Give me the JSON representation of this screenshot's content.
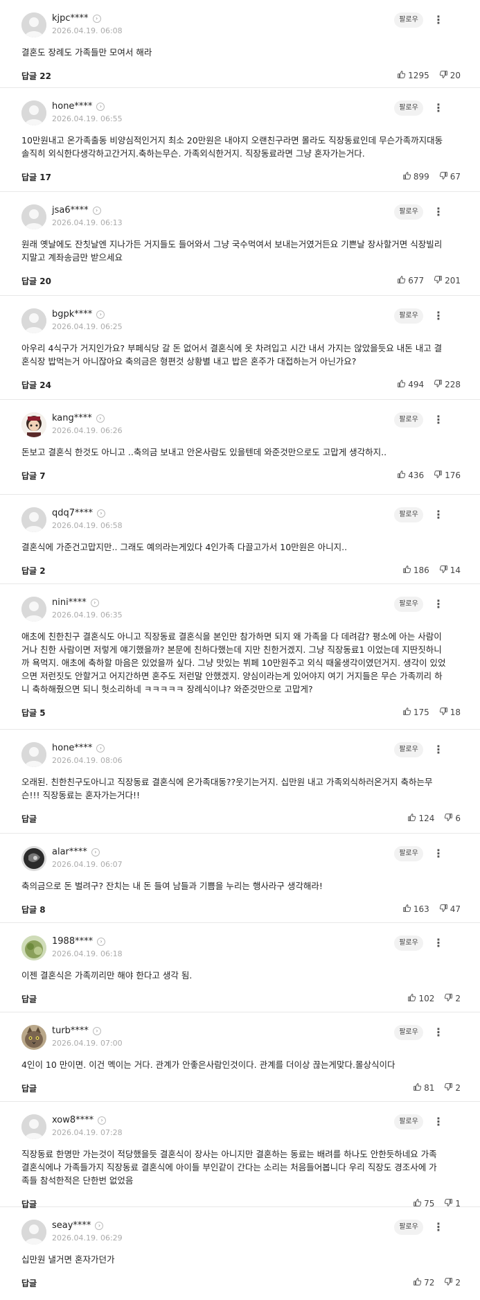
{
  "follow_label": "팔로우",
  "more_glyph": "⋮",
  "level_glyph": "›",
  "comments": [
    {
      "user": "kjpc****",
      "date": "2026.04.19. 06:08",
      "text": [
        "결혼도 장례도 가족들만 모여서 해라"
      ],
      "replies": "답글 22",
      "likes": "1295",
      "dislikes": "20",
      "avatar": "default"
    },
    {
      "user": "hone****",
      "date": "2026.04.19. 06:55",
      "text": [
        "10만원내고 온가족출동 비양심적인거지 최소 20만원은 내야지 오랜친구라면 몰라도 직장동료인데 무슨가족까지대동",
        "솔직히 외식한다생각하고간거지.축하는무슨. 가족외식한거지. 직장동료라면 그냥 혼자가는거다."
      ],
      "replies": "답글 17",
      "likes": "899",
      "dislikes": "67",
      "avatar": "default"
    },
    {
      "user": "jsa6****",
      "date": "2026.04.19. 06:13",
      "text": [
        "원래 옛날에도 잔칫날엔 지나가든 거지들도 들어와서 그냥 국수먹여서 보내는거였거든요 기쁜날 장사할거면 식장빌리",
        "지말고 계좌송금만 받으세요"
      ],
      "replies": "답글 20",
      "likes": "677",
      "dislikes": "201",
      "avatar": "default"
    },
    {
      "user": "bgpk****",
      "date": "2026.04.19. 06:25",
      "text": [
        "아우리 4식구가 거지인가요? 부페식당 갈 돈 없어서 결혼식에 옷 차려입고 시간 내서 가지는 않았을듯요 내돈 내고 결",
        "혼식장 밥먹는거 아니잖아요 축의금은 형편것 상황별 내고 밥은 혼주가 대접하는거 아닌가요?"
      ],
      "replies": "답글 24",
      "likes": "494",
      "dislikes": "228",
      "avatar": "default"
    },
    {
      "user": "kang****",
      "date": "2026.04.19. 06:26",
      "text": [
        "돈보고 결혼식 한것도 아니고 ..축의금 보내고 안온사람도 있을텐데 와준것만으로도 고맙게 생각하지.."
      ],
      "replies": "답글 7",
      "likes": "436",
      "dislikes": "176",
      "avatar": "character"
    },
    {
      "user": "qdq7****",
      "date": "2026.04.19. 06:58",
      "text": [
        "결혼식에 가준건고맙지만.. 그래도 예의라는게있다 4인가족 다끌고가서 10만원은 아니지.."
      ],
      "replies": "답글 2",
      "likes": "186",
      "dislikes": "14",
      "avatar": "default"
    },
    {
      "user": "nini****",
      "date": "2026.04.19. 06:35",
      "text": [
        "애초에 친한친구 결혼식도 아니고 직장동료 결혼식을 본인만 참가하면 되지 왜 가족을 다 데려감? 평소에 아는 사람이",
        "거나 친한 사람이면 저렇게 얘기했을까? 본문에 친하다했는데 지만 친한거겠지. 그냥 직장동료1 이었는데 지딴짓하니",
        "까 욕먹지. 애초에 축하할 마음은 있었을까 싶다. 그냥 맛있는 뷔페 10만원주고 외식 때울생각이였던거지. 생각이 있었",
        "으면 저런짓도 안할거고 어지간하면 혼주도 저런말 안했겠지. 양심이라는게 있어야지 여기 거지들은 무슨 가족끼리 하",
        "니 축하해줬으면 되니 헛소리하네 ㅋㅋㅋㅋㅋ 장례식이냐? 와준것만으로 고맙게?"
      ],
      "replies": "답글 5",
      "likes": "175",
      "dislikes": "18",
      "avatar": "default"
    },
    {
      "user": "hone****",
      "date": "2026.04.19. 08:06",
      "text": [
        "오래된. 친한친구도아니고 직장동료 결혼식에 온가족대동??웃기는거지. 십만원 내고 가족외식하러온거지 축하는무",
        "슨!!! 직장동료는 혼자가는거다!!"
      ],
      "replies": "답글",
      "likes": "124",
      "dislikes": "6",
      "avatar": "default"
    },
    {
      "user": "alar****",
      "date": "2026.04.19. 06:07",
      "text": [
        "축의금으로 돈 벌려구? 잔치는 내 돈 들여 남들과 기쁨을 누리는 행사라구 생각해라!"
      ],
      "replies": "답글 8",
      "likes": "163",
      "dislikes": "47",
      "avatar": "dark"
    },
    {
      "user": "1988****",
      "date": "2026.04.19. 06:18",
      "text": [
        "이젠 결혼식은 가족끼리만 해야 한다고 생각 됨."
      ],
      "replies": "답글",
      "likes": "102",
      "dislikes": "2",
      "avatar": "green"
    },
    {
      "user": "turb****",
      "date": "2026.04.19. 07:00",
      "text": [
        "4인이 10 만이면. 이건 멕이는 거다. 관계가 안좋은사람인것이다. 관계를 더이상 끊는게맞다.몰상식이다"
      ],
      "replies": "답글",
      "likes": "81",
      "dislikes": "2",
      "avatar": "cat"
    },
    {
      "user": "xow8****",
      "date": "2026.04.19. 07:28",
      "text": [
        "직장동료 한명만 가는것이 적당했을듯 결혼식이 장사는 아니지만 결혼하는 동료는 배려를 하나도 안한듯하네요 가족",
        "결혼식에나 가족들가지 직장동료 결혼식에 아이들 부인같이 간다는 소리는 처음들어봅니다 우리 직장도 경조사에 가",
        "족들 참석한적은 단한번 없었음"
      ],
      "replies": "답글",
      "likes": "75",
      "dislikes": "1",
      "avatar": "default"
    },
    {
      "user": "seay****",
      "date": "2026.04.19. 06:29",
      "text": [
        "십만원 낼거면 혼자가던가"
      ],
      "replies": "답글",
      "likes": "72",
      "dislikes": "2",
      "avatar": "default"
    }
  ]
}
